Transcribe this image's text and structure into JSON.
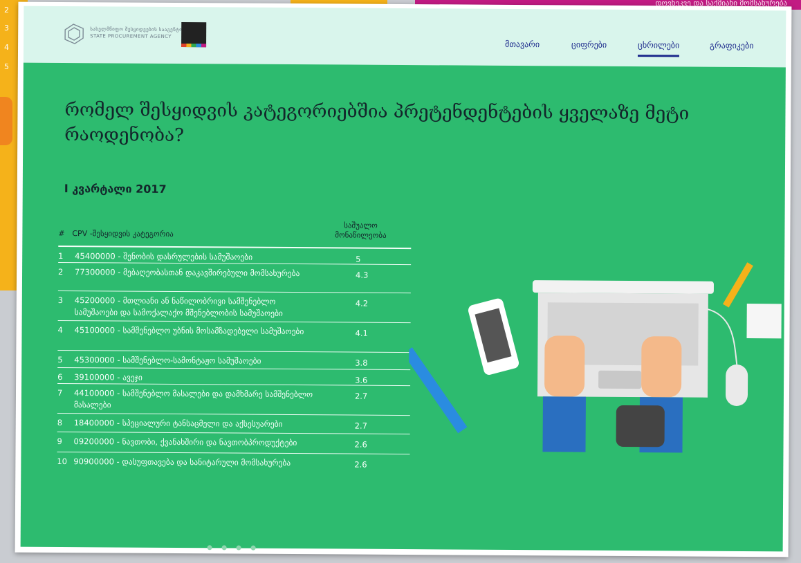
{
  "background": {
    "side_numbers": [
      "2",
      "3",
      "4",
      "5"
    ],
    "magenta_text": "დოვნეკვე და საქმიანი მომსახურება"
  },
  "header": {
    "logo_text": "სახელმწიფო შესყიდვების სააგენტო",
    "logo_text_en": "STATE PROCUREMENT AGENCY",
    "nav": [
      "მთავარი",
      "ციფრები",
      "ცხრილები",
      "გრაფიკები"
    ],
    "active_nav_index": 2
  },
  "main": {
    "title": "რომელ შესყიდვის კატეგორიებშია პრეტენდენტების ყველაზე მეტი რაოდენობა?",
    "subtitle": "I კვარტალი 2017",
    "table": {
      "headers": {
        "num": "#",
        "cpv": "CPV -შესყიდვის კატეგორია",
        "avg": "საშუალო მონაწილეობა"
      },
      "rows": [
        {
          "n": "1",
          "desc": "45400000 - შენობის დასრულების სამუშაოები",
          "val": "5"
        },
        {
          "n": "2",
          "desc": "77300000 - მებაღეობასთან დაკავშირებული მომსახურება",
          "val": "4.3"
        },
        {
          "n": "3",
          "desc": "45200000 - მთლიანი ან ნაწილობრივი სამშენებლო სამუშაოები და სამოქალაქო მშენებლობის სამუშაოები",
          "val": "4.2"
        },
        {
          "n": "4",
          "desc": "45100000 - სამშენებლო უბნის მოსამზადებელი სამუშაოები",
          "val": "4.1"
        },
        {
          "n": "5",
          "desc": "45300000 - სამშენებლო-სამონტაჟო სამუშაოები",
          "val": "3.8"
        },
        {
          "n": "6",
          "desc": "39100000 - ავეჯი",
          "val": "3.6"
        },
        {
          "n": "7",
          "desc": "44100000 - სამშენებლო მასალები და დამხმარე სამშენებლო მასალები",
          "val": "2.7"
        },
        {
          "n": "8",
          "desc": "18400000 - სპეციალური ტანსაცმელი და აქსესუარები",
          "val": "2.7"
        },
        {
          "n": "9",
          "desc": "09200000 - ნავთობი, ქვანახშირი და ნავთობპროდუქტები",
          "val": "2.6"
        },
        {
          "n": "10",
          "desc": "90900000 - დასუფთავება და სანიტარული მომსახურება",
          "val": "2.6"
        }
      ]
    },
    "pager_dots": 4
  }
}
